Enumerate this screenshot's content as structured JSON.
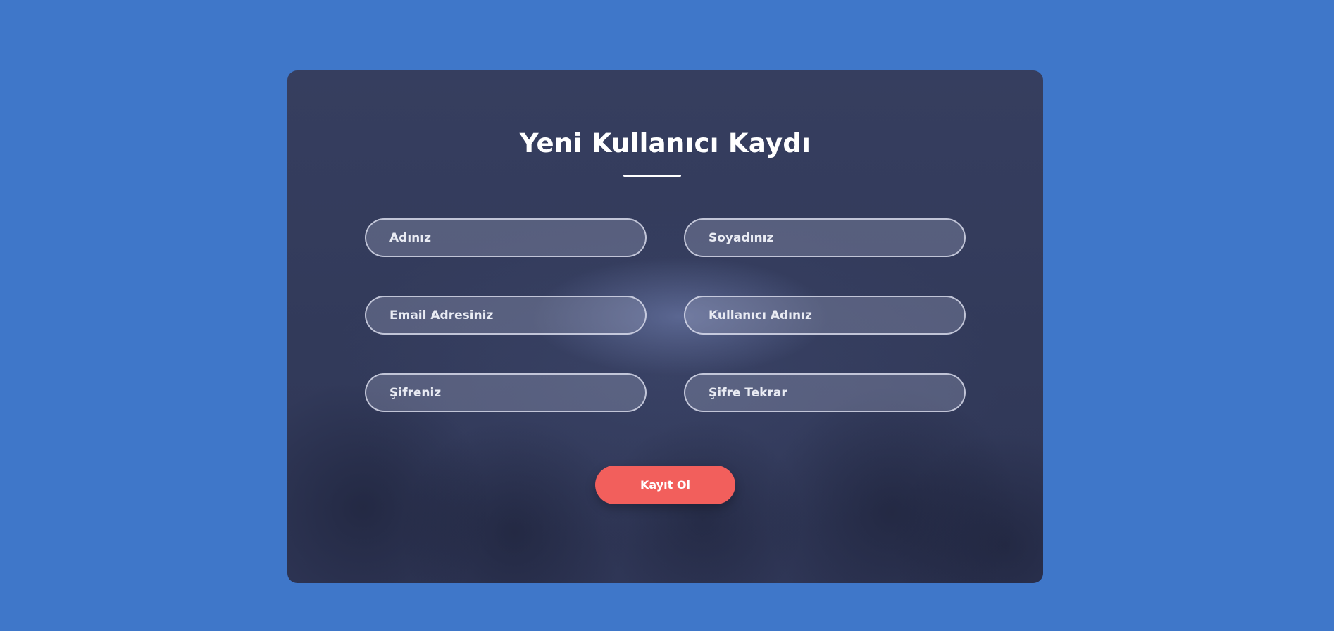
{
  "form": {
    "title": "Yeni Kullanıcı Kaydı",
    "fields": {
      "first_name": {
        "placeholder": "Adınız",
        "value": ""
      },
      "last_name": {
        "placeholder": "Soyadınız",
        "value": ""
      },
      "email": {
        "placeholder": "Email Adresiniz",
        "value": ""
      },
      "username": {
        "placeholder": "Kullanıcı Adınız",
        "value": ""
      },
      "password": {
        "placeholder": "Şifreniz",
        "value": ""
      },
      "password_repeat": {
        "placeholder": "Şifre Tekrar",
        "value": ""
      }
    },
    "submit_label": "Kayıt Ol"
  },
  "colors": {
    "page_background": "#3f77c9",
    "card_background": "#343c5d",
    "button": "#f25f5c",
    "text": "#ffffff"
  }
}
